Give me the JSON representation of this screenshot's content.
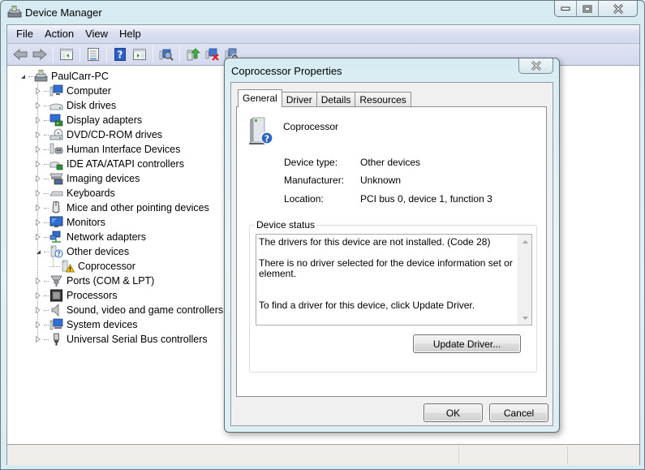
{
  "window": {
    "title": "Device Manager",
    "icon": "device-manager-icon"
  },
  "menu": {
    "items": [
      "File",
      "Action",
      "View",
      "Help"
    ]
  },
  "toolbar": {
    "buttons": [
      {
        "icon": "back-arrow-icon"
      },
      {
        "icon": "forward-arrow-icon"
      },
      {
        "icon": "show-hide-console-tree-icon"
      },
      {
        "icon": "properties-icon"
      },
      {
        "icon": "help-icon"
      },
      {
        "icon": "show-hide-action-pane-icon"
      },
      {
        "icon": "scan-hardware-changes-icon"
      },
      {
        "icon": "update-driver-icon"
      },
      {
        "icon": "uninstall-device-icon"
      },
      {
        "icon": "disable-device-icon"
      }
    ]
  },
  "tree": {
    "root": {
      "label": "PaulCarr-PC",
      "expanded": true,
      "icon": "computer-root-icon"
    },
    "items": [
      {
        "label": "Computer",
        "icon": "computer-icon",
        "expanded": false
      },
      {
        "label": "Disk drives",
        "icon": "disk-drive-icon",
        "expanded": false
      },
      {
        "label": "Display adapters",
        "icon": "display-adapter-icon",
        "expanded": false
      },
      {
        "label": "DVD/CD-ROM drives",
        "icon": "dvd-drive-icon",
        "expanded": false
      },
      {
        "label": "Human Interface Devices",
        "icon": "hid-icon",
        "expanded": false
      },
      {
        "label": "IDE ATA/ATAPI controllers",
        "icon": "ide-controller-icon",
        "expanded": false
      },
      {
        "label": "Imaging devices",
        "icon": "imaging-device-icon",
        "expanded": false
      },
      {
        "label": "Keyboards",
        "icon": "keyboard-icon",
        "expanded": false
      },
      {
        "label": "Mice and other pointing devices",
        "icon": "mouse-icon",
        "expanded": false
      },
      {
        "label": "Monitors",
        "icon": "monitor-icon",
        "expanded": false
      },
      {
        "label": "Network adapters",
        "icon": "network-adapter-icon",
        "expanded": false
      },
      {
        "label": "Other devices",
        "icon": "unknown-device-icon",
        "expanded": true,
        "children": [
          {
            "label": "Coprocessor",
            "icon": "warning-device-icon"
          }
        ]
      },
      {
        "label": "Ports (COM & LPT)",
        "icon": "port-icon",
        "expanded": false
      },
      {
        "label": "Processors",
        "icon": "processor-icon",
        "expanded": false
      },
      {
        "label": "Sound, video and game controllers",
        "icon": "speaker-icon",
        "expanded": false
      },
      {
        "label": "System devices",
        "icon": "system-device-icon",
        "expanded": false
      },
      {
        "label": "Universal Serial Bus controllers",
        "icon": "usb-icon",
        "expanded": false
      }
    ]
  },
  "dialog": {
    "title": "Coprocessor Properties",
    "tabs": [
      "General",
      "Driver",
      "Details",
      "Resources"
    ],
    "active_tab": "General",
    "device_name": "Coprocessor",
    "properties": [
      {
        "label": "Device type:",
        "value": "Other devices"
      },
      {
        "label": "Manufacturer:",
        "value": "Unknown"
      },
      {
        "label": "Location:",
        "value": "PCI bus 0, device 1, function 3"
      }
    ],
    "status_group_label": "Device status",
    "status_lines": [
      "The drivers for this device are not installed. (Code 28)",
      "",
      "There is no driver selected for the device information set or element.",
      "",
      "",
      "To find a driver for this device, click Update Driver."
    ],
    "update_driver_label": "Update Driver...",
    "ok_label": "OK",
    "cancel_label": "Cancel"
  }
}
